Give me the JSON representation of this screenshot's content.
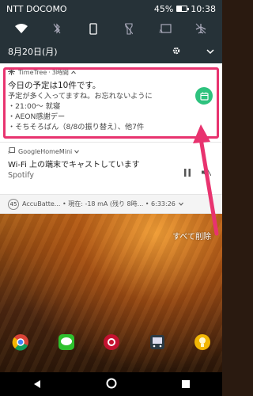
{
  "statusbar": {
    "carrier": "NTT DOCOMO",
    "battery": "45%",
    "battery_level": 0.45,
    "time": "10:38"
  },
  "quick_settings": {
    "tiles": [
      "wifi-icon",
      "bluetooth-icon",
      "phone-rotate-icon",
      "flashlight-icon",
      "cast-icon",
      "airplane-icon"
    ],
    "date": "8月20日(月)"
  },
  "notifications": {
    "timetree": {
      "app_name": "TimeTree",
      "time_ago": "3時間",
      "title": "今日の予定は10件です。",
      "body_line1": "予定が多く入ってますね。お忘れないように",
      "body_line2": "・21:00〜 就寝",
      "body_line3": "・AEON感謝デー",
      "body_line4": "・そちそろばん（8/8の振り替え）、他7件",
      "highlight_color": "#e8336f",
      "action_color": "#2ec27e"
    },
    "googlehome": {
      "app_name": "GoogleHomeMini",
      "title": "Wi-Fi 上の端末でキャストしています",
      "subtitle": "Spotify"
    },
    "accubattery": {
      "badge": "45",
      "text": "AccuBatte... • 現在: -18 mA (残り 8時... • 6:33:26"
    }
  },
  "clear_all": "すべて削除",
  "dock": {
    "apps": [
      "chrome-icon",
      "line-icon",
      "camera-icon",
      "train-icon",
      "lightbulb-icon"
    ]
  },
  "navbar": {
    "buttons": [
      "back-button",
      "home-button",
      "recents-button"
    ]
  },
  "annotation_color": "#e8336f"
}
